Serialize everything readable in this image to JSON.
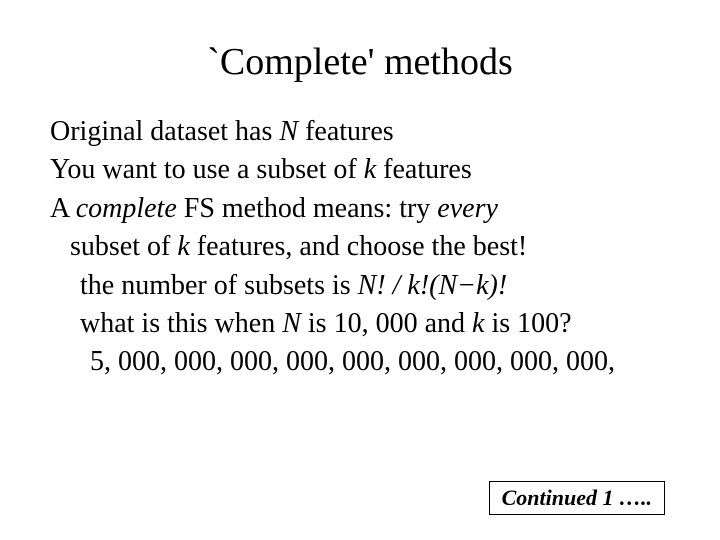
{
  "slide": {
    "title": "`Complete' methods",
    "lines": {
      "l1_pre": "Original dataset has ",
      "l1_n": "N",
      "l1_post": " features",
      "l2_pre": "You want to use a subset of ",
      "l2_k": "k",
      "l2_post": " features",
      "l3_pre": "A ",
      "l3_complete": "complete",
      "l3_mid": " FS method means:  try ",
      "l3_every": "every",
      "l4_pre": "subset of ",
      "l4_k": "k",
      "l4_post": " features, and choose the best!",
      "l5_pre": "the number of subsets is ",
      "l5_formula": "N! / k!(N−k)!",
      "l6_pre": "what is this when ",
      "l6_n": "N",
      "l6_mid": " is 10, 000 and ",
      "l6_k": "k",
      "l6_post": " is 100?",
      "l7": "5, 000, 000, 000, 000, 000, 000, 000, 000, 000,"
    },
    "footer": "Continued 1 ….."
  }
}
